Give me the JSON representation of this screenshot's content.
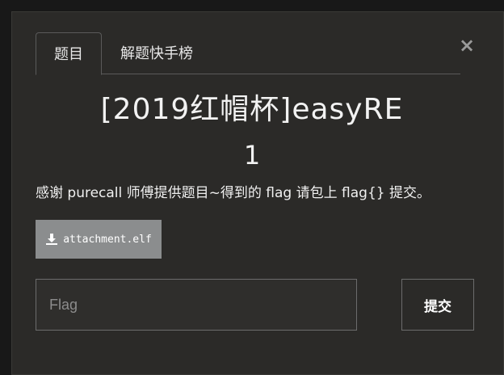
{
  "tabs": [
    {
      "label": "题目",
      "active": true
    },
    {
      "label": "解题快手榜",
      "active": false
    }
  ],
  "close_symbol": "×",
  "challenge": {
    "title": "[2019红帽杯]easyRE",
    "points": "1",
    "description": "感谢 purecall 师傅提供题目~得到的 flag 请包上 flag{} 提交。"
  },
  "attachment": {
    "icon": "download-icon",
    "label": "attachment.elf"
  },
  "flag_input": {
    "placeholder": "Flag",
    "value": ""
  },
  "submit": {
    "label": "提交"
  },
  "colors": {
    "modal_bg": "#2b2a28",
    "attachment_bg": "#8b8d8e",
    "border": "#6c6c6c"
  }
}
